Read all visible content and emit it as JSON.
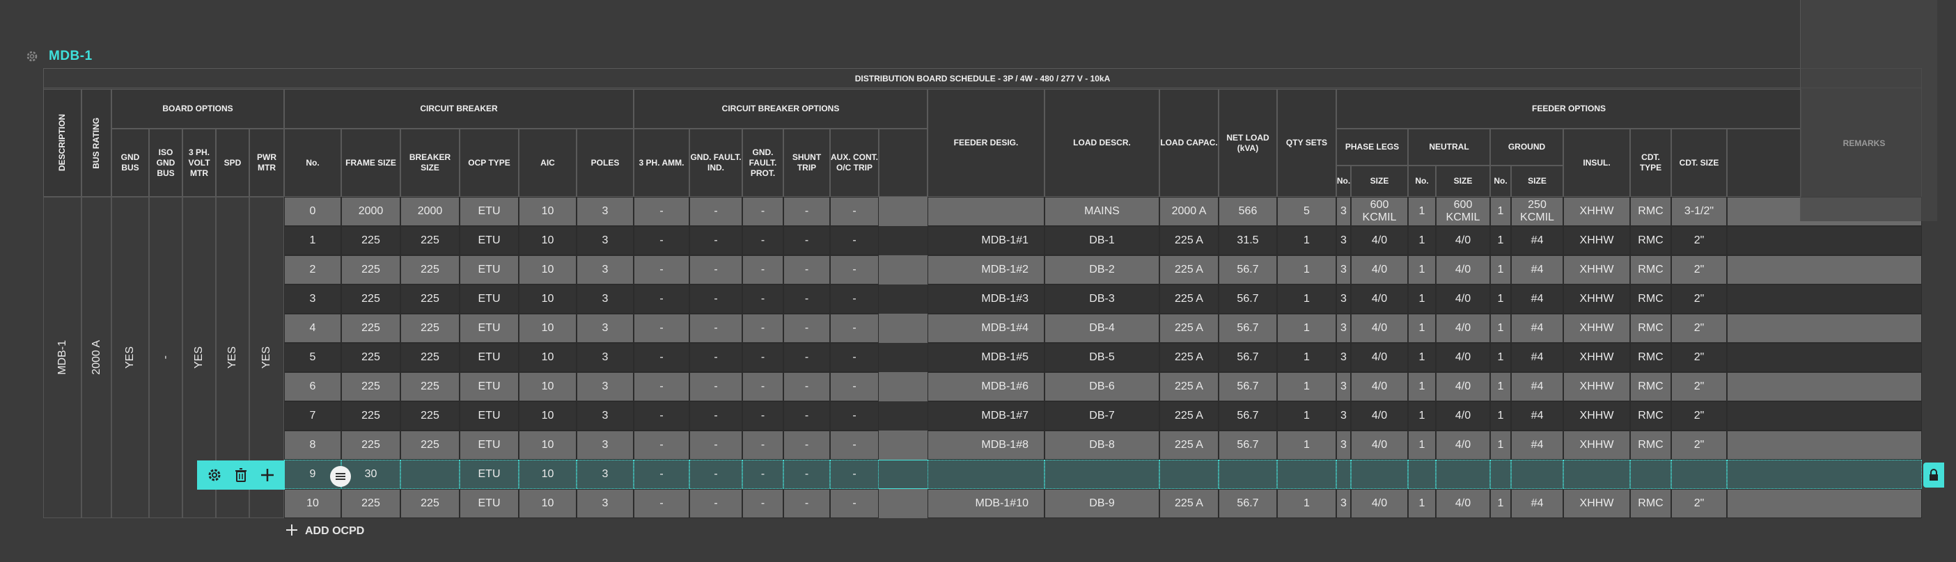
{
  "board": {
    "title": "MDB-1"
  },
  "schedule_title": "DISTRIBUTION BOARD SCHEDULE - 3P / 4W - 480 / 277 V - 10kA",
  "headers": {
    "description": "DESCRIPTION",
    "bus_rating": "BUS RATING",
    "board_options": "BOARD OPTIONS",
    "gnd_bus": "GND BUS",
    "iso_gnd_bus": "ISO GND BUS",
    "volt_mtr": "3 PH. VOLT MTR",
    "spd": "SPD",
    "pwr_mtr": "PWR MTR",
    "circuit_breaker": "CIRCUIT BREAKER",
    "no": "No.",
    "frame_size": "FRAME SIZE",
    "breaker_size": "BREAKER SIZE",
    "ocp_type": "OCP TYPE",
    "aic": "AIC",
    "poles": "POLES",
    "cb_options": "CIRCUIT BREAKER OPTIONS",
    "amm": "3 PH. AMM.",
    "gf_ind": "GND. FAULT. IND.",
    "gf_prot": "GND. FAULT. PROT.",
    "shunt": "SHUNT TRIP",
    "aux": "AUX. CONT. O/C TRIP",
    "feeder_desig": "FEEDER DESIG.",
    "load_descr": "LOAD DESCR.",
    "load_capac": "LOAD CAPAC.",
    "net_load": "NET LOAD (kVA)",
    "qty_sets": "QTY SETS",
    "feeder_options": "FEEDER OPTIONS",
    "phase_legs": "PHASE LEGS",
    "neutral": "NEUTRAL",
    "ground": "GROUND",
    "sub_no": "No.",
    "sub_size": "SIZE",
    "insul": "INSUL.",
    "cdt_type": "CDT. TYPE",
    "cdt_size": "CDT. SIZE",
    "remarks": "REMARKS"
  },
  "merged": {
    "description": "MDB-1",
    "bus_rating": "2000 A",
    "gnd_bus": "YES",
    "iso_gnd_bus": "-",
    "volt_mtr": "YES",
    "spd": "YES",
    "pwr_mtr": "YES"
  },
  "rows": [
    [
      "0",
      "2000",
      "2000",
      "ETU",
      "10",
      "3",
      "-",
      "-",
      "-",
      "-",
      "-",
      "",
      "MAINS",
      "2000 A",
      "566",
      "5",
      "3",
      "600 KCMIL",
      "1",
      "600 KCMIL",
      "1",
      "250 KCMIL",
      "XHHW",
      "RMC",
      "3-1/2\""
    ],
    [
      "1",
      "225",
      "225",
      "ETU",
      "10",
      "3",
      "-",
      "-",
      "-",
      "-",
      "-",
      "MDB-1#1",
      "DB-1",
      "225 A",
      "31.5",
      "1",
      "3",
      "4/0",
      "1",
      "4/0",
      "1",
      "#4",
      "XHHW",
      "RMC",
      "2\""
    ],
    [
      "2",
      "225",
      "225",
      "ETU",
      "10",
      "3",
      "-",
      "-",
      "-",
      "-",
      "-",
      "MDB-1#2",
      "DB-2",
      "225 A",
      "56.7",
      "1",
      "3",
      "4/0",
      "1",
      "4/0",
      "1",
      "#4",
      "XHHW",
      "RMC",
      "2\""
    ],
    [
      "3",
      "225",
      "225",
      "ETU",
      "10",
      "3",
      "-",
      "-",
      "-",
      "-",
      "-",
      "MDB-1#3",
      "DB-3",
      "225 A",
      "56.7",
      "1",
      "3",
      "4/0",
      "1",
      "4/0",
      "1",
      "#4",
      "XHHW",
      "RMC",
      "2\""
    ],
    [
      "4",
      "225",
      "225",
      "ETU",
      "10",
      "3",
      "-",
      "-",
      "-",
      "-",
      "-",
      "MDB-1#4",
      "DB-4",
      "225 A",
      "56.7",
      "1",
      "3",
      "4/0",
      "1",
      "4/0",
      "1",
      "#4",
      "XHHW",
      "RMC",
      "2\""
    ],
    [
      "5",
      "225",
      "225",
      "ETU",
      "10",
      "3",
      "-",
      "-",
      "-",
      "-",
      "-",
      "MDB-1#5",
      "DB-5",
      "225 A",
      "56.7",
      "1",
      "3",
      "4/0",
      "1",
      "4/0",
      "1",
      "#4",
      "XHHW",
      "RMC",
      "2\""
    ],
    [
      "6",
      "225",
      "225",
      "ETU",
      "10",
      "3",
      "-",
      "-",
      "-",
      "-",
      "-",
      "MDB-1#6",
      "DB-6",
      "225 A",
      "56.7",
      "1",
      "3",
      "4/0",
      "1",
      "4/0",
      "1",
      "#4",
      "XHHW",
      "RMC",
      "2\""
    ],
    [
      "7",
      "225",
      "225",
      "ETU",
      "10",
      "3",
      "-",
      "-",
      "-",
      "-",
      "-",
      "MDB-1#7",
      "DB-7",
      "225 A",
      "56.7",
      "1",
      "3",
      "4/0",
      "1",
      "4/0",
      "1",
      "#4",
      "XHHW",
      "RMC",
      "2\""
    ],
    [
      "8",
      "225",
      "225",
      "ETU",
      "10",
      "3",
      "-",
      "-",
      "-",
      "-",
      "-",
      "MDB-1#8",
      "DB-8",
      "225 A",
      "56.7",
      "1",
      "3",
      "4/0",
      "1",
      "4/0",
      "1",
      "#4",
      "XHHW",
      "RMC",
      "2\""
    ],
    [
      "9",
      "30",
      "",
      "ETU",
      "10",
      "3",
      "-",
      "-",
      "-",
      "-",
      "-",
      "",
      "",
      "",
      "",
      "",
      "",
      "",
      "",
      "",
      "",
      "",
      "",
      "",
      ""
    ],
    [
      "10",
      "225",
      "225",
      "ETU",
      "10",
      "3",
      "-",
      "-",
      "-",
      "-",
      "-",
      "MDB-1#10",
      "DB-9",
      "225 A",
      "56.7",
      "1",
      "3",
      "4/0",
      "1",
      "4/0",
      "1",
      "#4",
      "XHHW",
      "RMC",
      "2\""
    ]
  ],
  "selected_row": 9,
  "add_ocpd": "ADD OCPD",
  "colors": {
    "accent": "#45dfd8",
    "header_bg": "#363636",
    "row_light": "#6b6b6b",
    "row_dark": "#333333",
    "selected_bg": "#3c5a5a"
  },
  "icons": {
    "gear": "gear-icon",
    "trash": "trash-icon",
    "plus": "plus-icon",
    "drag": "drag-handle-icon",
    "lock": "lock-icon"
  }
}
